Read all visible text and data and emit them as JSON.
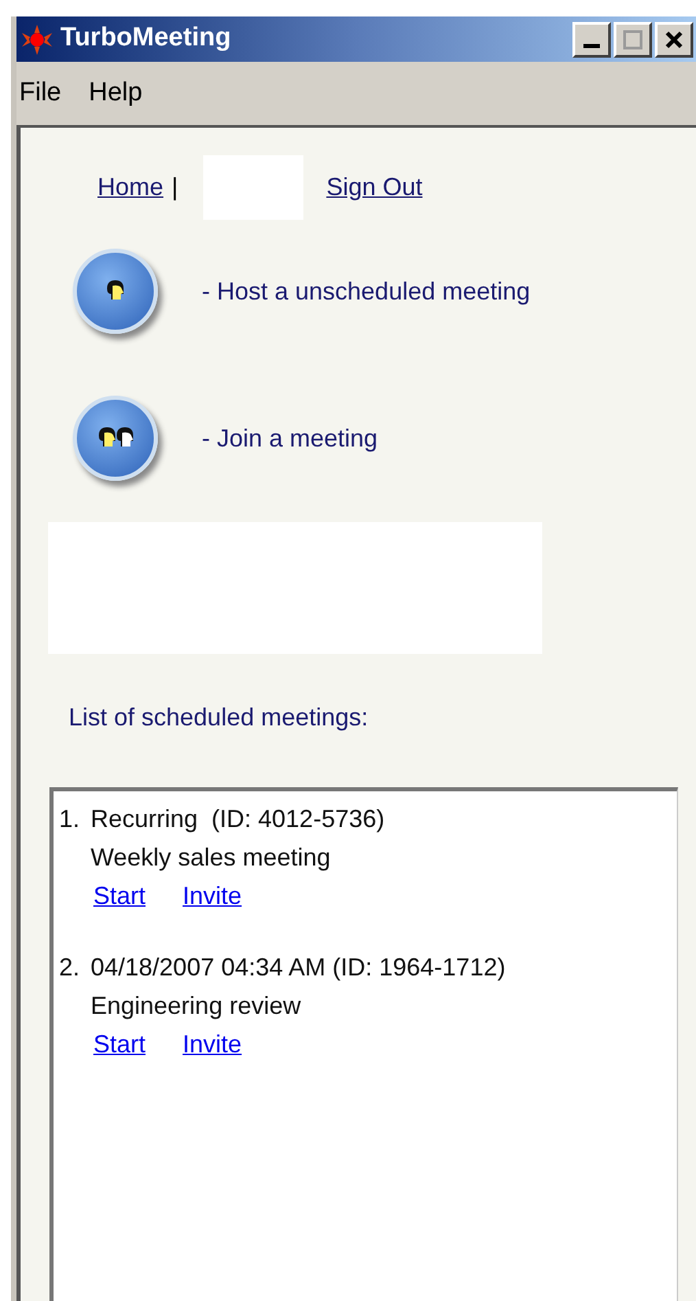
{
  "window": {
    "title": "TurboMeeting"
  },
  "menu": [
    "File",
    "Help"
  ],
  "nav": {
    "home": "Home",
    "separator": "|",
    "sign_out": "Sign Out"
  },
  "actions": [
    {
      "kind": "host",
      "label": "- Host a unscheduled meeting"
    },
    {
      "kind": "join",
      "label": "- Join a meeting"
    }
  ],
  "list_heading": "List of scheduled meetings:",
  "meetings": [
    {
      "number": "1.",
      "title": "Recurring  (ID: 4012-5736)",
      "description": "Weekly sales meeting",
      "links": [
        "Start",
        "Invite"
      ]
    },
    {
      "number": "2.",
      "title": "04/18/2007 04:34 AM (ID: 1964-1712)",
      "description": "Engineering review",
      "links": [
        "Start",
        "Invite"
      ]
    }
  ]
}
